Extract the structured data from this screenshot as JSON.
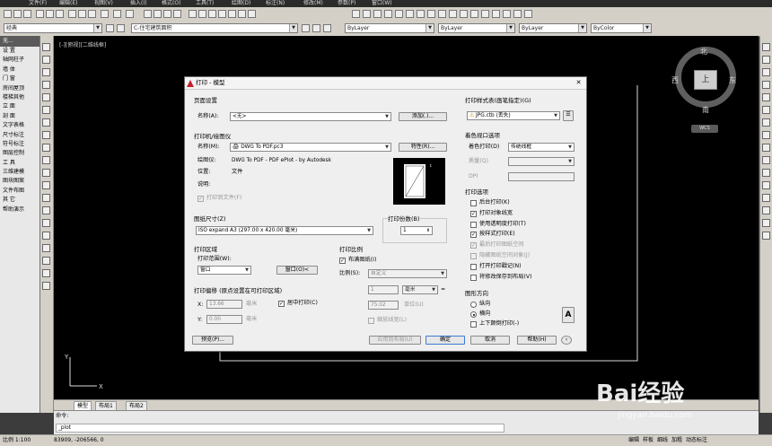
{
  "menubar": {
    "items": [
      "文件(F)",
      "编辑(E)",
      "视图(V)",
      "插入(I)",
      "格式(O)",
      "工具(T)",
      "绘图(D)",
      "标注(N)",
      "修改(M)",
      "参数(P)",
      "窗口(W)"
    ]
  },
  "toolbar2": {
    "workspace": "经典",
    "layer": "C-住宅建筑面积",
    "color": "ByLayer",
    "linetype": "ByLayer",
    "lineweight": "ByLayer",
    "plotstyle": "ByColor"
  },
  "palette": {
    "title": "无...",
    "items": [
      "设 置",
      "轴网柱子",
      "墙 体",
      "门 窗",
      "房间屋顶",
      "楼梯其他",
      "立 面",
      "剖 面",
      "文字表格",
      "尺寸标注",
      "符号标注",
      "图层控制",
      "工 具",
      "三维建模",
      "图块图案",
      "文件布图",
      "其 它",
      "帮助演示"
    ]
  },
  "canvas": {
    "view_label": "[-][俯视][二维线框]",
    "compass": {
      "north": "北",
      "south": "南",
      "east": "东",
      "west": "西",
      "top": "上"
    },
    "wcs": "WCS"
  },
  "tabs": [
    "模型",
    "布局1",
    "布局2"
  ],
  "command": {
    "prompt_label": "命令:",
    "input": "_plot"
  },
  "statusbar": {
    "scale": "比例 1:100",
    "coords": "83909, -206566, 0",
    "modes": [
      "编辑",
      "样板",
      "细线",
      "加粗",
      "动态标注"
    ]
  },
  "watermark": {
    "brand": "Bai经验",
    "url": "jingyan.baidu.com"
  },
  "dialog": {
    "title": "打印 - 模型",
    "page_setup": {
      "section": "页面设置",
      "name_label": "名称(A):",
      "name_value": "<无>",
      "add_button": "添加(.)..."
    },
    "printer": {
      "section": "打印机/绘图仪",
      "name_label": "名称(M):",
      "name_value": "DWG To PDF.pc3",
      "properties_button": "特性(R)...",
      "plotter_label": "绘图仪:",
      "plotter_value": "DWG To PDF - PDF ePlot - by Autodesk",
      "location_label": "位置:",
      "location_value": "文件",
      "desc_label": "说明:",
      "print_to_file": "打印到文件(F)"
    },
    "paper": {
      "section": "图纸尺寸(Z)",
      "value": "ISO expand A3 (297.00 x 420.00 毫米)"
    },
    "copies": {
      "section": "打印份数(B)",
      "value": "1"
    },
    "area": {
      "section": "打印区域",
      "range_label": "打印范围(W):",
      "range_value": "窗口",
      "window_button": "窗口(O)<"
    },
    "scale": {
      "section": "打印比例",
      "fit_paper": "布满图纸(I)",
      "scale_label": "比例(S):",
      "scale_value": "自定义",
      "num_value": "1",
      "unit_value": "毫米",
      "eq": "=",
      "den_value": "75.02",
      "den_unit": "单位(U)",
      "scale_lineweights": "缩放线宽(L)"
    },
    "offset": {
      "section": "打印偏移 (原点设置在可打印区域)",
      "x_label": "X:",
      "x_value": "13.66",
      "x_unit": "毫米",
      "y_label": "Y:",
      "y_value": "0.00",
      "y_unit": "毫米",
      "center": "居中打印(C)"
    },
    "style_table": {
      "section": "打印样式表(画笔指定)(G)",
      "value": "JPG.ctb (丢失)"
    },
    "shaded": {
      "section": "着色视口选项",
      "shade_label": "着色打印(D)",
      "shade_value": "传统线框",
      "quality_label": "质量(Q)",
      "dpi_label": "DPI"
    },
    "options": {
      "section": "打印选项",
      "items": [
        {
          "label": "后台打印(K)",
          "checked": false,
          "disabled": false
        },
        {
          "label": "打印对象线宽",
          "checked": true,
          "disabled": false
        },
        {
          "label": "使用透明度打印(T)",
          "checked": false,
          "disabled": false
        },
        {
          "label": "按样式打印(E)",
          "checked": true,
          "disabled": false
        },
        {
          "label": "最后打印图纸空间",
          "checked": true,
          "disabled": true
        },
        {
          "label": "隐藏图纸空间对象(J)",
          "checked": false,
          "disabled": true
        },
        {
          "label": "打开打印戳记(N)",
          "checked": false,
          "disabled": false
        },
        {
          "label": "将修改保存到布局(V)",
          "checked": false,
          "disabled": false
        }
      ]
    },
    "orientation": {
      "section": "图形方向",
      "portrait": "纵向",
      "landscape": "横向",
      "upside_down": "上下颠倒打印(-)"
    },
    "buttons": {
      "preview": "预览(P)...",
      "apply_layout": "应用到布局(U)",
      "ok": "确定",
      "cancel": "取消",
      "help": "帮助(H)"
    }
  }
}
